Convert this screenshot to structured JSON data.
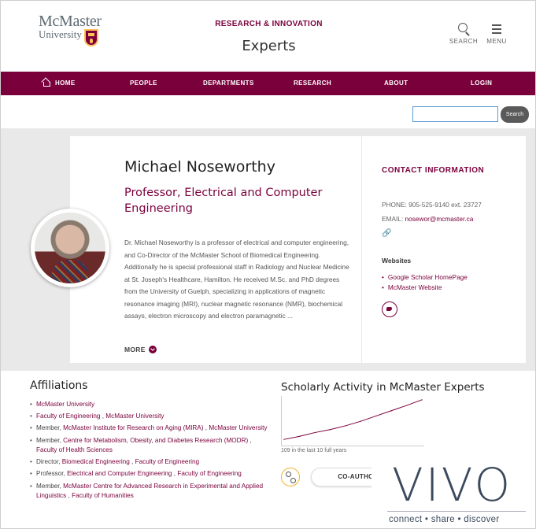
{
  "header": {
    "logo_line1": "McMaster",
    "logo_line2": "University",
    "supertitle": "RESEARCH & INNOVATION",
    "site_title": "Experts",
    "search_label": "SEARCH",
    "menu_label": "MENU"
  },
  "nav": {
    "items": [
      "HOME",
      "PEOPLE",
      "DEPARTMENTS",
      "RESEARCH",
      "ABOUT",
      "LOGIN"
    ]
  },
  "search": {
    "value": "",
    "button_label": "Search"
  },
  "profile": {
    "name": "Michael Noseworthy",
    "position": "Professor, Electrical and Computer Engineering",
    "overview": "Dr. Michael Noseworthy is a professor of electrical and computer engineering, and Co-Director of the McMaster School of Biomedical Engineering. Additionally he is special professional staff in Radiology and Nuclear Medicine at St. Joseph's Healthcare, Hamilton. He received M.Sc. and PhD degrees from the University of Guelph, specializing in applications of magnetic resonance imaging (MRI), nuclear magnetic resonance (NMR), biochemical assays, electron microscopy and electron paramagnetic ...",
    "more_label": "MORE"
  },
  "contact": {
    "title": "CONTACT INFORMATION",
    "phone_label": "PHONE:",
    "phone": "905-525-9140 ext. 23727",
    "email_label": "EMAIL:",
    "email": "nosewor@mcmaster.ca",
    "websites_title": "Websites",
    "websites": [
      "Google Scholar HomePage",
      "McMaster Website"
    ]
  },
  "affiliations": {
    "title": "Affiliations",
    "items": [
      {
        "prefix": "",
        "org": "McMaster University",
        "sep": "",
        "parent": ""
      },
      {
        "prefix": "",
        "org": "Faculty of Engineering",
        "sep": " , ",
        "parent": "McMaster University"
      },
      {
        "prefix": "Member, ",
        "org": "McMaster Institute for Research on Aging (MIRA)",
        "sep": " , ",
        "parent": "McMaster University"
      },
      {
        "prefix": "Member, ",
        "org": "Centre for Metabolism, Obesity, and Diabetes Research (MODR)",
        "sep": " , ",
        "parent": "Faculty of Health Sciences"
      },
      {
        "prefix": "Director, ",
        "org": "Biomedical Engineering",
        "sep": " , ",
        "parent": "Faculty of Engineering"
      },
      {
        "prefix": "Professor, ",
        "org": "Electrical and Computer Engineering",
        "sep": " , ",
        "parent": "Faculty of Engineering"
      },
      {
        "prefix": "Member, ",
        "org": "McMaster Centre for Advanced Research in Experimental and Applied Linguistics",
        "sep": " , ",
        "parent": "Faculty of Humanities"
      }
    ]
  },
  "scholarly": {
    "title": "Scholarly Activity in McMaster Experts",
    "caption": "109 in the last 10 full years",
    "coauthor_label": "CO-AUTHOR"
  },
  "vivo": {
    "word": "VIVO",
    "tagline": "connect • share • discover"
  },
  "colors": {
    "brand": "#7a003c",
    "gold": "#fdbf57",
    "vivo": "#3b4a5c"
  },
  "chart_data": {
    "type": "line",
    "title": "",
    "xlabel": "",
    "ylabel": "",
    "x": [
      1,
      2,
      3,
      4,
      5,
      6,
      7,
      8,
      9,
      10
    ],
    "series": [
      {
        "values": [
          4,
          12,
          22,
          30,
          40,
          52,
          66,
          80,
          94,
          109
        ]
      }
    ],
    "ylim": [
      0,
      115
    ],
    "grid": false
  }
}
